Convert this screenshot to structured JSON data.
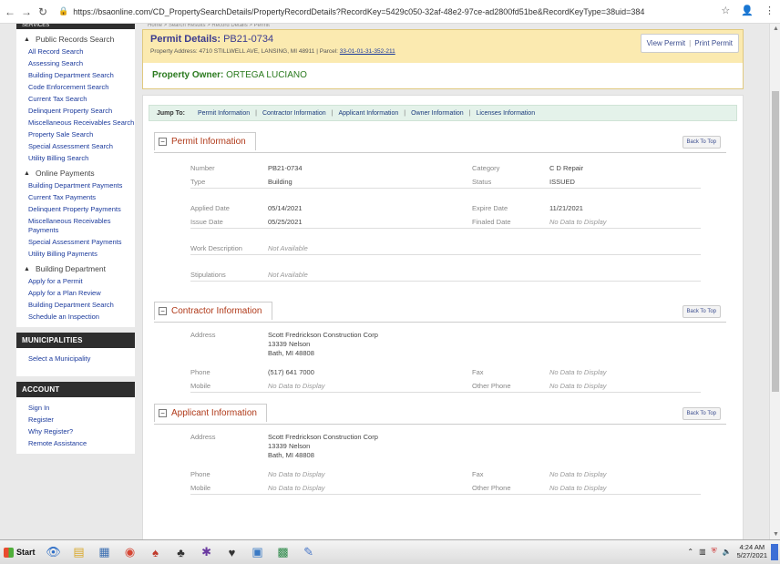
{
  "browser": {
    "url": "https://bsaonline.com/CD_PropertySearchDetails/PropertyRecordDetails?RecordKey=5429c050-32af-48e2-97ce-ad2800fd51be&RecordKeyType=38uid=384"
  },
  "sidebar": {
    "top_strip": "SERVICES",
    "public_records": {
      "title": "Public Records Search",
      "items": [
        "All Record Search",
        "Assessing Search",
        "Building Department Search",
        "Code Enforcement Search",
        "Current Tax Search",
        "Delinquent Property Search",
        "Miscellaneous Receivables Search",
        "Property Sale Search",
        "Special Assessment Search",
        "Utility Billing Search"
      ]
    },
    "online_payments": {
      "title": "Online Payments",
      "items": [
        "Building Department Payments",
        "Current Tax Payments",
        "Delinquent Property Payments",
        "Miscellaneous Receivables Payments",
        "Special Assessment Payments",
        "Utility Billing Payments"
      ]
    },
    "building_department": {
      "title": "Building Department",
      "items": [
        "Apply for a Permit",
        "Apply for a Plan Review",
        "Building Department Search",
        "Schedule an Inspection"
      ]
    },
    "municipalities": {
      "title": "MUNICIPALITIES",
      "items": [
        "Select a Municipality"
      ]
    },
    "account": {
      "title": "ACCOUNT",
      "items": [
        "Sign In",
        "Register",
        "Why Register?",
        "Remote Assistance"
      ]
    }
  },
  "breadcrumb": "Home > Search Results > Record Details > Permit",
  "permit": {
    "title_label": "Permit Details:",
    "number": "PB21-0734",
    "address_label": "Property Address:",
    "address": "4710 STILLWELL AVE, LANSING, MI 48911",
    "parcel_label": "Parcel:",
    "parcel": "33-01-01-31-352-211",
    "view_permit": "View Permit",
    "print_permit": "Print Permit",
    "owner_label": "Property Owner:",
    "owner": "ORTEGA LUCIANO"
  },
  "jump": {
    "label": "Jump To:",
    "links": [
      "Permit Information",
      "Contractor Information",
      "Applicant Information",
      "Owner Information",
      "Licenses Information"
    ]
  },
  "back_to_top": "Back To Top",
  "permit_info": {
    "title": "Permit Information",
    "number_label": "Number",
    "number": "PB21-0734",
    "category_label": "Category",
    "category": "C D Repair",
    "type_label": "Type",
    "type": "Building",
    "status_label": "Status",
    "status": "ISSUED",
    "applied_label": "Applied Date",
    "applied": "05/14/2021",
    "expire_label": "Expire Date",
    "expire": "11/21/2021",
    "issue_label": "Issue Date",
    "issue": "05/25/2021",
    "finaled_label": "Finaled Date",
    "finaled": "No Data to Display",
    "work_label": "Work Description",
    "work": "Not Available",
    "stip_label": "Stipulations",
    "stip": "Not Available"
  },
  "contractor_info": {
    "title": "Contractor Information",
    "address_label": "Address",
    "address_line1": "Scott Fredrickson Construction Corp",
    "address_line2": "13339 Nelson",
    "address_line3": "Bath, MI 48808",
    "phone_label": "Phone",
    "phone": "(517) 641 7000",
    "fax_label": "Fax",
    "fax": "No Data to Display",
    "mobile_label": "Mobile",
    "mobile": "No Data to Display",
    "other_label": "Other Phone",
    "other": "No Data to Display"
  },
  "applicant_info": {
    "title": "Applicant Information",
    "address_label": "Address",
    "address_line1": "Scott Fredrickson Construction Corp",
    "address_line2": "13339 Nelson",
    "address_line3": "Bath, MI 48808",
    "phone_label": "Phone",
    "phone": "No Data to Display",
    "fax_label": "Fax",
    "fax": "No Data to Display",
    "mobile_label": "Mobile",
    "mobile": "No Data to Display",
    "other_label": "Other Phone",
    "other": "No Data to Display"
  },
  "taskbar": {
    "start": "Start",
    "time": "4:24 AM",
    "date": "5/27/2021"
  }
}
